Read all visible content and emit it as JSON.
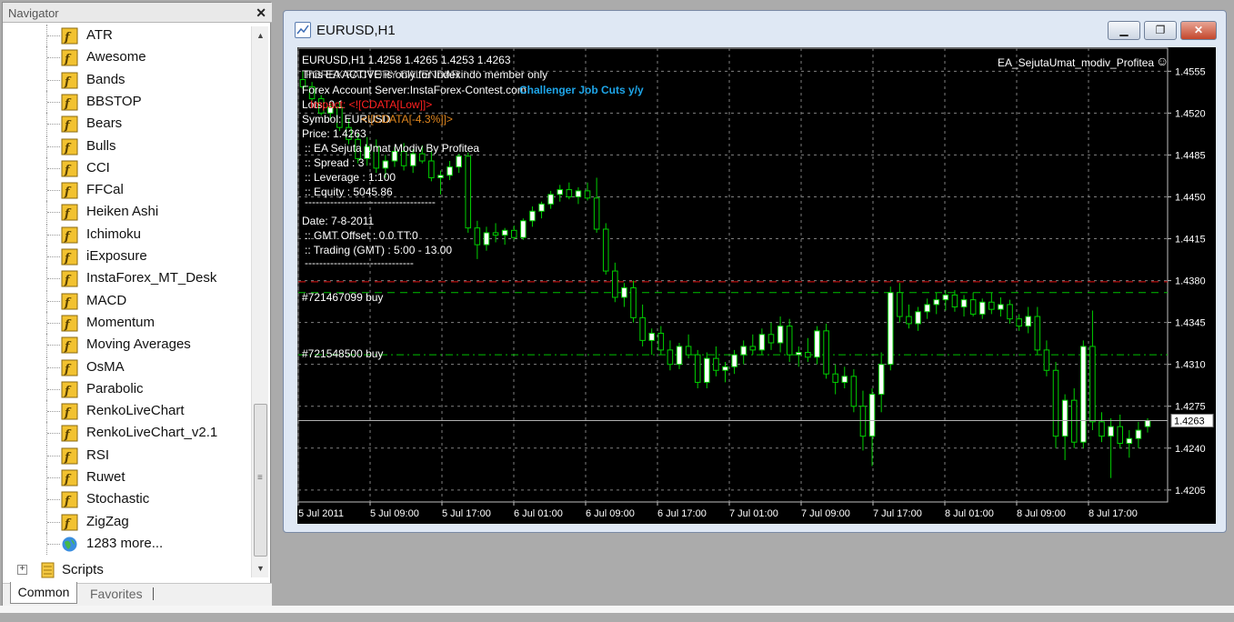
{
  "navigator": {
    "title": "Navigator",
    "close": "✕",
    "items": [
      {
        "label": "ATR"
      },
      {
        "label": "Awesome"
      },
      {
        "label": "Bands"
      },
      {
        "label": "BBSTOP"
      },
      {
        "label": "Bears"
      },
      {
        "label": "Bulls"
      },
      {
        "label": "CCI"
      },
      {
        "label": "FFCal"
      },
      {
        "label": "Heiken Ashi"
      },
      {
        "label": "Ichimoku"
      },
      {
        "label": "iExposure"
      },
      {
        "label": "InstaForex_MT_Desk"
      },
      {
        "label": "MACD"
      },
      {
        "label": "Momentum"
      },
      {
        "label": "Moving Averages"
      },
      {
        "label": "OsMA"
      },
      {
        "label": "Parabolic"
      },
      {
        "label": "RenkoLiveChart"
      },
      {
        "label": "RenkoLiveChart_v2.1"
      },
      {
        "label": "RSI"
      },
      {
        "label": "Ruwet"
      },
      {
        "label": "Stochastic"
      },
      {
        "label": "ZigZag"
      },
      {
        "label": "1283 more..."
      }
    ],
    "scripts_label": "Scripts",
    "tabs": {
      "common": "Common",
      "favorites": "Favorites"
    }
  },
  "chart_window": {
    "title": "EURUSD,H1",
    "min": "▁",
    "max": "❐",
    "close": "✕"
  },
  "chart_overlay": {
    "ohlc": "EURUSD,H1  1.4258 1.4265 1.4253 1.4263",
    "ea_name": "EA_SejutaUmat_modiv_Profitea",
    "smiley": "☺",
    "line1": "This EA ACTIVE is only for Indexindo member only",
    "line1b": "FOREX FACTORY CALENDAR",
    "line2": "Forex Account Server:InstaForex-Contest.com",
    "line2b": "Challenger Job Cuts y/y",
    "line3": "Lots:  0.1",
    "line3b": "Impact: <![CDATA[Low]]>",
    "line4": "Symbol: EURUSD",
    "line4b": "<![CDATA[-4.3%]]>",
    "line5": "Price:  1.4263",
    "line6": ":: EA Sejuta Umat Modiv By Profitea",
    "line7": ":: Spread          : 3",
    "line8": ":: Leverage        : 1:100",
    "line9": ":: Equity           : 5045.86",
    "dashes": "------------------------------------",
    "line10": "Date: 7-8-2011",
    "line11": ":: GMT Offset        : 0.0 TT:0",
    "line12": ":: Trading (GMT)      : 5:00 - 13.00",
    "dashes2": "------------------------------",
    "order1": "#721467099 buy",
    "order2": "#721548500 buy"
  },
  "chart_data": {
    "type": "candlestick",
    "symbol": "EURUSD",
    "timeframe": "H1",
    "ylim": [
      1.4195,
      1.4575
    ],
    "y_ticks": [
      "1.4555",
      "1.4520",
      "1.4485",
      "1.4450",
      "1.4415",
      "1.4380",
      "1.4345",
      "1.4310",
      "1.4275",
      "1.4240",
      "1.4205"
    ],
    "x_ticks": [
      "5 Jul 2011",
      "5 Jul 09:00",
      "5 Jul 17:00",
      "6 Jul 01:00",
      "6 Jul 09:00",
      "6 Jul 17:00",
      "7 Jul 01:00",
      "7 Jul 09:00",
      "7 Jul 17:00",
      "8 Jul 01:00",
      "8 Jul 09:00",
      "8 Jul 17:00"
    ],
    "current_price": "1.4263",
    "levels": {
      "red_dashed": 1.4379,
      "green_upper": 1.437,
      "green_lower": 1.4318
    },
    "colors": {
      "bull": "#ffffff",
      "bear": "#00d000",
      "wick": "#00d000",
      "grid": "#808080",
      "axis_text": "#ffffff"
    },
    "candles": [
      [
        1.4548,
        1.4555,
        1.454,
        1.4542
      ],
      [
        1.4542,
        1.4546,
        1.453,
        1.4532
      ],
      [
        1.4532,
        1.4535,
        1.4518,
        1.452
      ],
      [
        1.452,
        1.4528,
        1.4515,
        1.4525
      ],
      [
        1.4525,
        1.453,
        1.4505,
        1.4508
      ],
      [
        1.4508,
        1.4515,
        1.4494,
        1.4498
      ],
      [
        1.4498,
        1.4503,
        1.4478,
        1.4482
      ],
      [
        1.4482,
        1.45,
        1.4476,
        1.4492
      ],
      [
        1.4492,
        1.4498,
        1.447,
        1.4474
      ],
      [
        1.4474,
        1.4485,
        1.4466,
        1.448
      ],
      [
        1.448,
        1.4492,
        1.4475,
        1.4488
      ],
      [
        1.4488,
        1.4495,
        1.4472,
        1.4476
      ],
      [
        1.4476,
        1.449,
        1.447,
        1.4486
      ],
      [
        1.4486,
        1.4493,
        1.4478,
        1.448
      ],
      [
        1.448,
        1.4488,
        1.4463,
        1.4466
      ],
      [
        1.4466,
        1.4472,
        1.4452,
        1.4468
      ],
      [
        1.4468,
        1.448,
        1.4464,
        1.4475
      ],
      [
        1.4475,
        1.4486,
        1.447,
        1.4484
      ],
      [
        1.4484,
        1.4487,
        1.442,
        1.4424
      ],
      [
        1.4424,
        1.443,
        1.4398,
        1.441
      ],
      [
        1.441,
        1.4425,
        1.4405,
        1.442
      ],
      [
        1.442,
        1.4428,
        1.4412,
        1.4418
      ],
      [
        1.4418,
        1.4424,
        1.441,
        1.4422
      ],
      [
        1.4422,
        1.4426,
        1.4414,
        1.4416
      ],
      [
        1.4416,
        1.4432,
        1.4414,
        1.443
      ],
      [
        1.443,
        1.4442,
        1.4425,
        1.4438
      ],
      [
        1.4438,
        1.4446,
        1.4432,
        1.4444
      ],
      [
        1.4444,
        1.4455,
        1.444,
        1.4452
      ],
      [
        1.4452,
        1.446,
        1.4446,
        1.4456
      ],
      [
        1.4456,
        1.4462,
        1.4448,
        1.445
      ],
      [
        1.445,
        1.4458,
        1.4444,
        1.4455
      ],
      [
        1.4455,
        1.4462,
        1.4447,
        1.4449
      ],
      [
        1.4449,
        1.4466,
        1.442,
        1.4423
      ],
      [
        1.4423,
        1.4428,
        1.4385,
        1.4388
      ],
      [
        1.4388,
        1.4395,
        1.4362,
        1.4366
      ],
      [
        1.4366,
        1.4378,
        1.4358,
        1.4374
      ],
      [
        1.4374,
        1.438,
        1.4345,
        1.4349
      ],
      [
        1.4349,
        1.436,
        1.4325,
        1.433
      ],
      [
        1.433,
        1.434,
        1.4318,
        1.4336
      ],
      [
        1.4336,
        1.4342,
        1.4318,
        1.4322
      ],
      [
        1.4322,
        1.433,
        1.4305,
        1.431
      ],
      [
        1.431,
        1.4328,
        1.4306,
        1.4325
      ],
      [
        1.4325,
        1.4335,
        1.4315,
        1.4318
      ],
      [
        1.4318,
        1.4322,
        1.429,
        1.4295
      ],
      [
        1.4295,
        1.432,
        1.429,
        1.4315
      ],
      [
        1.4315,
        1.4325,
        1.43,
        1.4305
      ],
      [
        1.4305,
        1.4312,
        1.4295,
        1.4308
      ],
      [
        1.4308,
        1.4322,
        1.4302,
        1.4318
      ],
      [
        1.4318,
        1.433,
        1.431,
        1.4325
      ],
      [
        1.4325,
        1.4335,
        1.4318,
        1.4322
      ],
      [
        1.4322,
        1.434,
        1.4318,
        1.4335
      ],
      [
        1.4335,
        1.4345,
        1.4322,
        1.4328
      ],
      [
        1.4328,
        1.435,
        1.432,
        1.4342
      ],
      [
        1.4342,
        1.4348,
        1.4312,
        1.4318
      ],
      [
        1.4318,
        1.4325,
        1.4308,
        1.432
      ],
      [
        1.432,
        1.4332,
        1.4312,
        1.4316
      ],
      [
        1.4316,
        1.4342,
        1.431,
        1.4338
      ],
      [
        1.4338,
        1.4344,
        1.4298,
        1.4302
      ],
      [
        1.4302,
        1.431,
        1.4285,
        1.4295
      ],
      [
        1.4295,
        1.4308,
        1.429,
        1.43
      ],
      [
        1.43,
        1.4306,
        1.427,
        1.4275
      ],
      [
        1.4275,
        1.4288,
        1.4238,
        1.425
      ],
      [
        1.425,
        1.429,
        1.4225,
        1.4285
      ],
      [
        1.4285,
        1.432,
        1.427,
        1.431
      ],
      [
        1.431,
        1.4375,
        1.4305,
        1.437
      ],
      [
        1.437,
        1.4378,
        1.4345,
        1.435
      ],
      [
        1.435,
        1.436,
        1.434,
        1.4344
      ],
      [
        1.4344,
        1.4358,
        1.4338,
        1.4354
      ],
      [
        1.4354,
        1.4365,
        1.4348,
        1.436
      ],
      [
        1.436,
        1.437,
        1.4352,
        1.4364
      ],
      [
        1.4364,
        1.4372,
        1.4355,
        1.4368
      ],
      [
        1.4368,
        1.4372,
        1.4354,
        1.4358
      ],
      [
        1.4358,
        1.4368,
        1.435,
        1.4364
      ],
      [
        1.4364,
        1.437,
        1.435,
        1.4352
      ],
      [
        1.4352,
        1.4365,
        1.4348,
        1.4362
      ],
      [
        1.4362,
        1.437,
        1.4352,
        1.4356
      ],
      [
        1.4356,
        1.4366,
        1.435,
        1.436
      ],
      [
        1.436,
        1.4364,
        1.4344,
        1.4348
      ],
      [
        1.4348,
        1.4352,
        1.4338,
        1.4342
      ],
      [
        1.4342,
        1.4358,
        1.4336,
        1.435
      ],
      [
        1.435,
        1.4358,
        1.4318,
        1.4322
      ],
      [
        1.4322,
        1.433,
        1.43,
        1.4305
      ],
      [
        1.4305,
        1.4312,
        1.424,
        1.425
      ],
      [
        1.425,
        1.4285,
        1.423,
        1.428
      ],
      [
        1.428,
        1.429,
        1.424,
        1.4245
      ],
      [
        1.4245,
        1.433,
        1.424,
        1.4325
      ],
      [
        1.4325,
        1.4355,
        1.4255,
        1.4262
      ],
      [
        1.4262,
        1.427,
        1.4245,
        1.425
      ],
      [
        1.425,
        1.4265,
        1.4215,
        1.4258
      ],
      [
        1.4258,
        1.4268,
        1.424,
        1.4244
      ],
      [
        1.4244,
        1.4255,
        1.4232,
        1.4248
      ],
      [
        1.4248,
        1.4262,
        1.424,
        1.4255
      ],
      [
        1.4258,
        1.4265,
        1.4253,
        1.4263
      ]
    ]
  }
}
